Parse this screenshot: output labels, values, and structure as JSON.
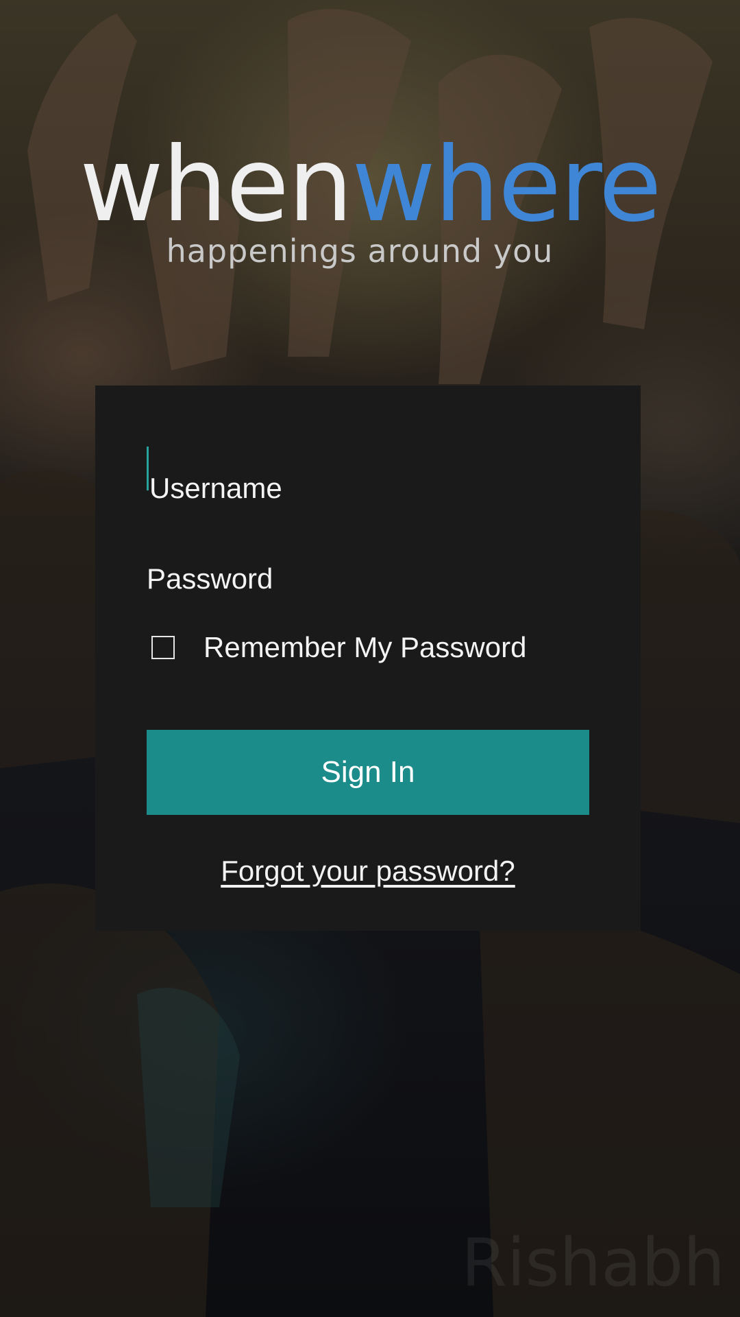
{
  "app": {
    "logo_part1": "when",
    "logo_part2": "where",
    "tagline": "happenings around you"
  },
  "login": {
    "username_placeholder": "Username",
    "password_placeholder": "Password",
    "remember_label": "Remember My Password",
    "remember_checked": false,
    "signin_label": "Sign In",
    "forgot_label": "Forgot your password?"
  },
  "watermark": "Rishabh",
  "colors": {
    "logo_primary": "#efefef",
    "logo_accent": "#3f86d6",
    "card_background": "#1a1a1a",
    "button_background": "#1b8c89",
    "caret": "#27a3a0"
  },
  "icons": {
    "checkbox": "empty-checkbox"
  }
}
